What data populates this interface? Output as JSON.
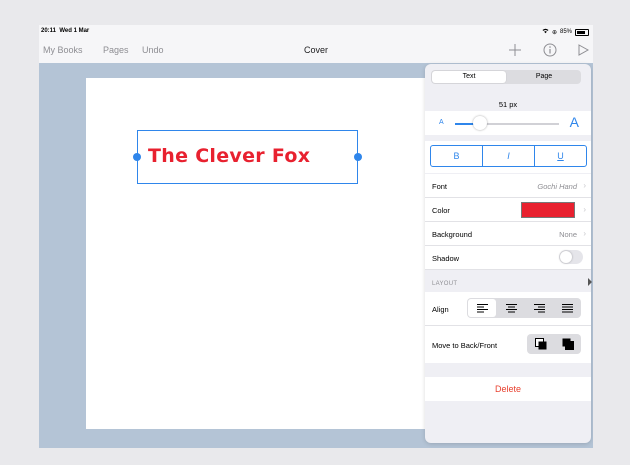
{
  "status_bar": {
    "time": "20:11",
    "date": "Wed 1 Mar",
    "battery": "85%"
  },
  "toolbar": {
    "my_books": "My Books",
    "pages": "Pages",
    "undo": "Undo",
    "title": "Cover",
    "add_icon": "plus-icon",
    "info_icon": "info-icon",
    "play_icon": "play-icon"
  },
  "canvas": {
    "text": "The Clever Fox",
    "text_color": "#e8212f"
  },
  "panel": {
    "tabs": [
      "Text",
      "Page"
    ],
    "active_tab": "Text",
    "font_size": "51 px",
    "font_size_value": 51,
    "slider_small": "A",
    "slider_large": "A",
    "style_buttons": [
      "B",
      "I",
      "U"
    ],
    "rows": {
      "font_label": "Font",
      "font_value": "Gochi Hand",
      "color_label": "Color",
      "color_value": "#e8212f",
      "background_label": "Background",
      "background_value": "None",
      "shadow_label": "Shadow",
      "shadow_on": false
    },
    "layout_header": "LAYOUT",
    "align_label": "Align",
    "align_options": [
      "left",
      "center",
      "right",
      "justify"
    ],
    "align_selected": "left",
    "move_label": "Move to Back/Front",
    "delete_label": "Delete"
  }
}
